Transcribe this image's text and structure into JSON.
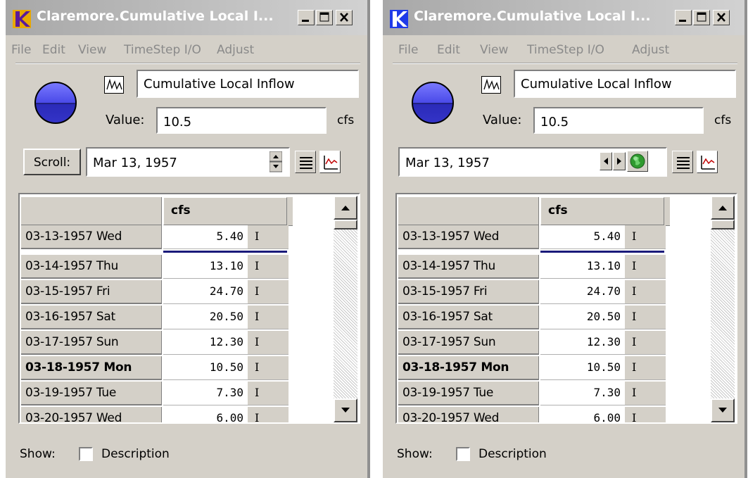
{
  "windows": [
    {
      "title": "Claremore.Cumulative Local I...",
      "menu": [
        "File",
        "Edit",
        "View",
        "TimeStep I/O",
        "Adjust"
      ],
      "slot_name": "Cumulative Local Inflow",
      "value_label": "Value:",
      "value": "10.5",
      "unit": "cfs",
      "scroll_label": "Scroll:",
      "date": "Mar 13, 1957",
      "column_header": "cfs",
      "rows": [
        {
          "date": "03-13-1957 Wed",
          "value": "5.40",
          "flag": "I"
        },
        {
          "date": "03-14-1957 Thu",
          "value": "13.10",
          "flag": "I"
        },
        {
          "date": "03-15-1957 Fri",
          "value": "24.70",
          "flag": "I"
        },
        {
          "date": "03-16-1957 Sat",
          "value": "20.50",
          "flag": "I"
        },
        {
          "date": "03-17-1957 Sun",
          "value": "12.30",
          "flag": "I"
        },
        {
          "date": "03-18-1957 Mon",
          "value": "10.50",
          "flag": "I",
          "bold": true
        },
        {
          "date": "03-19-1957 Tue",
          "value": "7.30",
          "flag": "I"
        },
        {
          "date": "03-20-1957 Wed",
          "value": "6.00",
          "flag": "I"
        }
      ],
      "show_label": "Show:",
      "description_label": "Description",
      "description_checked": false
    },
    {
      "title": "Claremore.Cumulative Local I...",
      "menu": [
        "File",
        "Edit",
        "View",
        "TimeStep I/O",
        "Adjust"
      ],
      "slot_name": "Cumulative Local Inflow",
      "value_label": "Value:",
      "value": "10.5",
      "unit": "cfs",
      "date": "Mar 13, 1957",
      "column_header": "cfs",
      "rows": [
        {
          "date": "03-13-1957 Wed",
          "value": "5.40",
          "flag": "I"
        },
        {
          "date": "03-14-1957 Thu",
          "value": "13.10",
          "flag": "I"
        },
        {
          "date": "03-15-1957 Fri",
          "value": "24.70",
          "flag": "I"
        },
        {
          "date": "03-16-1957 Sat",
          "value": "20.50",
          "flag": "I"
        },
        {
          "date": "03-17-1957 Sun",
          "value": "12.30",
          "flag": "I"
        },
        {
          "date": "03-18-1957 Mon",
          "value": "10.50",
          "flag": "I",
          "bold": true
        },
        {
          "date": "03-19-1957 Tue",
          "value": "7.30",
          "flag": "I"
        },
        {
          "date": "03-20-1957 Wed",
          "value": "6.00",
          "flag": "I"
        }
      ],
      "show_label": "Show:",
      "description_label": "Description",
      "description_checked": false
    }
  ],
  "colors": {
    "title_text": "#ffffff",
    "menu_text": "#8a8a8a",
    "chrome": "#d4d0c8",
    "ball_blue": "#3a3ad8",
    "current_row_line": "#1a1a7a",
    "globe_green": "#2f9a2f"
  },
  "icons": [
    "app-icon",
    "minimize-icon",
    "maximize-icon",
    "close-icon",
    "slot-graph-icon",
    "spin-up-icon",
    "spin-down-icon",
    "list-view-icon",
    "plot-icon",
    "step-left-icon",
    "step-right-icon",
    "globe-icon",
    "scroll-up-icon",
    "scroll-down-icon"
  ]
}
